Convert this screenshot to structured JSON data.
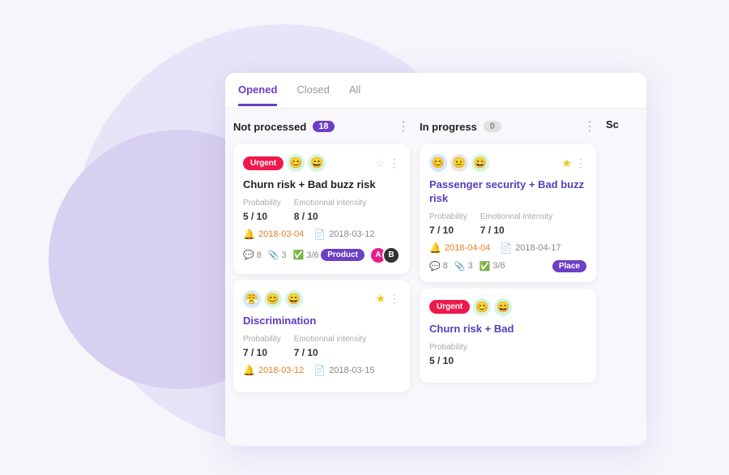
{
  "background": {
    "large_circle_color": "#e8e4f8",
    "small_circle_color": "#d8d0f0"
  },
  "tabs": {
    "items": [
      {
        "label": "Opened",
        "active": true
      },
      {
        "label": "Closed",
        "active": false
      },
      {
        "label": "All",
        "active": false
      }
    ]
  },
  "columns": [
    {
      "id": "not-processed",
      "title": "Not processed",
      "count": "18",
      "count_zero": false,
      "cards": [
        {
          "id": "card-1",
          "urgent": true,
          "emojis": [
            "😊",
            "😄"
          ],
          "emoji_colors": [
            "green",
            "green"
          ],
          "star": false,
          "title": "Churn risk + Bad buzz risk",
          "title_color": "normal",
          "probability_label": "Probability",
          "probability": "5 / 10",
          "intensity_label": "Emotionnal intensity",
          "intensity": "8 / 10",
          "date1": "2018-03-04",
          "date1_type": "warning",
          "date2": "2018-03-12",
          "date2_type": "normal",
          "comments": "8",
          "attachments": "3",
          "tasks": "3/6",
          "tag": "Product",
          "avatars": [
            "pink",
            "dark"
          ]
        },
        {
          "id": "card-2",
          "urgent": false,
          "emojis": [
            "😤",
            "😊",
            "😄"
          ],
          "emoji_colors": [
            "blue",
            "green",
            "green"
          ],
          "star": true,
          "title": "Discrimination",
          "title_color": "blue",
          "probability_label": "Probability",
          "probability": "7 / 10",
          "intensity_label": "Emotionnal intensity",
          "intensity": "7 / 10",
          "date1": "2018-03-12",
          "date1_type": "warning",
          "date2": "2018-03-15",
          "date2_type": "normal",
          "comments": "",
          "attachments": "",
          "tasks": "",
          "tag": "",
          "avatars": []
        }
      ]
    },
    {
      "id": "in-progress",
      "title": "In progress",
      "count": "0",
      "count_zero": true,
      "cards": [
        {
          "id": "card-3",
          "urgent": false,
          "emojis": [
            "😊",
            "😐",
            "😄"
          ],
          "emoji_colors": [
            "blue",
            "gray",
            "green"
          ],
          "star": true,
          "title": "Passenger security + Bad buzz risk",
          "title_color": "blue",
          "probability_label": "Probability",
          "probability": "7 / 10",
          "intensity_label": "Emotionnal intensity",
          "intensity": "7 / 10",
          "date1": "2018-04-04",
          "date1_type": "warning",
          "date2": "2018-04-17",
          "date2_type": "normal",
          "comments": "8",
          "attachments": "3",
          "tasks": "3/6",
          "tag": "Place",
          "avatars": []
        },
        {
          "id": "card-4",
          "urgent": true,
          "emojis": [
            "😊",
            "😄"
          ],
          "emoji_colors": [
            "green",
            "green"
          ],
          "star": false,
          "title": "Churn risk + Bad",
          "title_color": "blue",
          "probability_label": "Probability",
          "probability": "5 / 10",
          "intensity_label": "",
          "intensity": "",
          "date1": "",
          "date1_type": "",
          "date2": "",
          "date2_type": "",
          "comments": "",
          "attachments": "",
          "tasks": "",
          "tag": "",
          "avatars": []
        }
      ]
    }
  ],
  "third_column_label": "Sc"
}
